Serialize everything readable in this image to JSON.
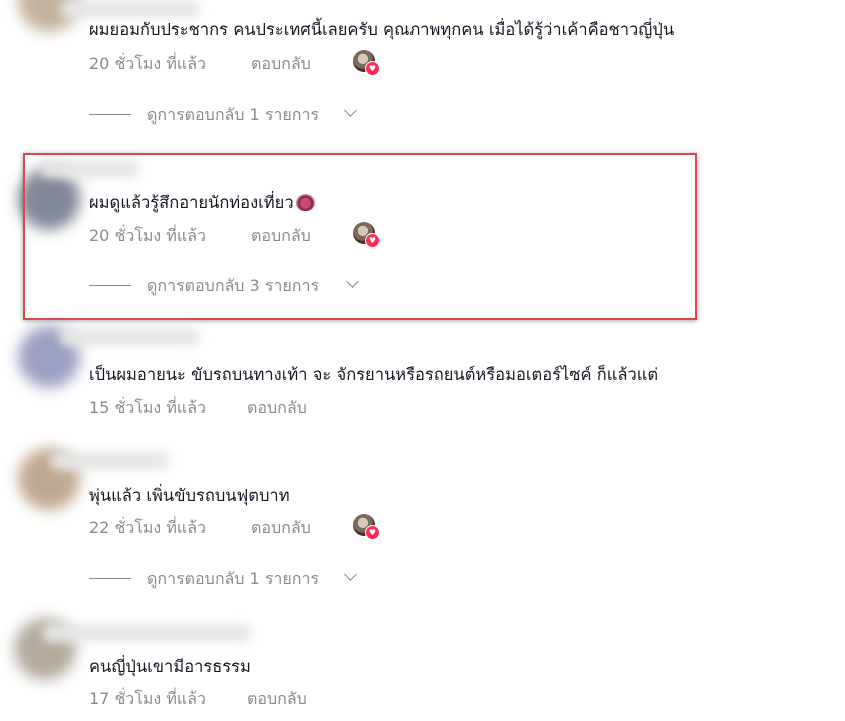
{
  "comments": [
    {
      "text": "ผมยอมกับประชากร คนประเทศนี้เลยครับ คุณภาพทุกคน เมื่อได้รู้ว่าเค้าคือชาวญี่ปุ่น",
      "time": "20 ชั่วโมง ที่แล้ว",
      "reply": "ตอบกลับ",
      "view_replies": "ดูการตอบกลับ 1 รายการ"
    },
    {
      "text": "ผมดูแล้วรู้สึกอายนักท่องเที่ยว",
      "time": "20 ชั่วโมง ที่แล้ว",
      "reply": "ตอบกลับ",
      "view_replies": "ดูการตอบกลับ 3 รายการ"
    },
    {
      "text": "เป็นผมอายนะ ขับรถบนทางเท้า จะ จักรยานหรือรถยนต์หรือมอเตอร์ไซค์ ก็แล้วแต่",
      "time": "15 ชั่วโมง ที่แล้ว",
      "reply": "ตอบกลับ"
    },
    {
      "text": "พุ่นแล้ว เพิ่นขับรถบนฟุตบาท",
      "time": "22 ชั่วโมง ที่แล้ว",
      "reply": "ตอบกลับ",
      "view_replies": "ดูการตอบกลับ 1 รายการ"
    },
    {
      "text": "คนญี่ปุ่นเขามีอารธรรม",
      "time": "17 ชั่วโมง ที่แล้ว",
      "reply": "ตอบกลับ"
    }
  ],
  "colors": {
    "highlight_border": "#e0474c",
    "meta_text": "#8a8b91",
    "heart_badge": "#fe2c55"
  },
  "icons": {
    "creator_liked": "creator-liked-avatar-icon",
    "heart": "heart-icon",
    "chevron": "chevron-down-icon",
    "emoji": "see-no-evil-monkey-emoji"
  }
}
